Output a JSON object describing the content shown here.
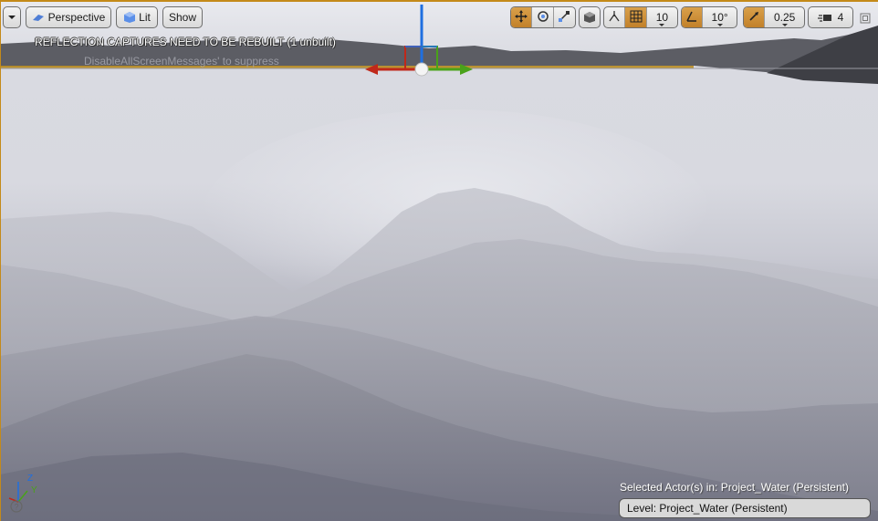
{
  "toolbar": {
    "perspective_label": "Perspective",
    "lit_label": "Lit",
    "show_label": "Show",
    "grid_snap_value": "10",
    "rotation_snap_value": "10°",
    "scale_snap_value": "0.25",
    "camera_speed_value": "4"
  },
  "messages": {
    "reflection_warning": "REFLECTION CAPTURES NEED TO BE REBUILT (1 unbuilt)",
    "suppress_hint": "DisableAllScreenMessages' to suppress"
  },
  "status": {
    "selected_actors": "Selected Actor(s) in:  Project_Water (Persistent)",
    "level": "Level:  Project_Water (Persistent)"
  },
  "axis": {
    "x": "X",
    "y": "Y",
    "z": "Z"
  },
  "colors": {
    "accent_orange": "#c48a1a",
    "gizmo_x": "#c0281a",
    "gizmo_y": "#4aa21a",
    "gizmo_z": "#1f6fe0"
  },
  "icons": {
    "viewport_menu": "chevron-down-icon",
    "perspective": "perspective-icon",
    "lit": "lit-cube-icon",
    "translate": "translate-icon",
    "rotate": "rotate-icon",
    "scale": "scale-icon",
    "surface_snap": "surface-snap-icon",
    "grid": "grid-icon",
    "rotation_snap": "angle-icon",
    "scale_snap": "scale-snap-icon",
    "camera_speed": "camera-speed-icon",
    "maximize": "maximize-icon",
    "help": "help-icon"
  }
}
